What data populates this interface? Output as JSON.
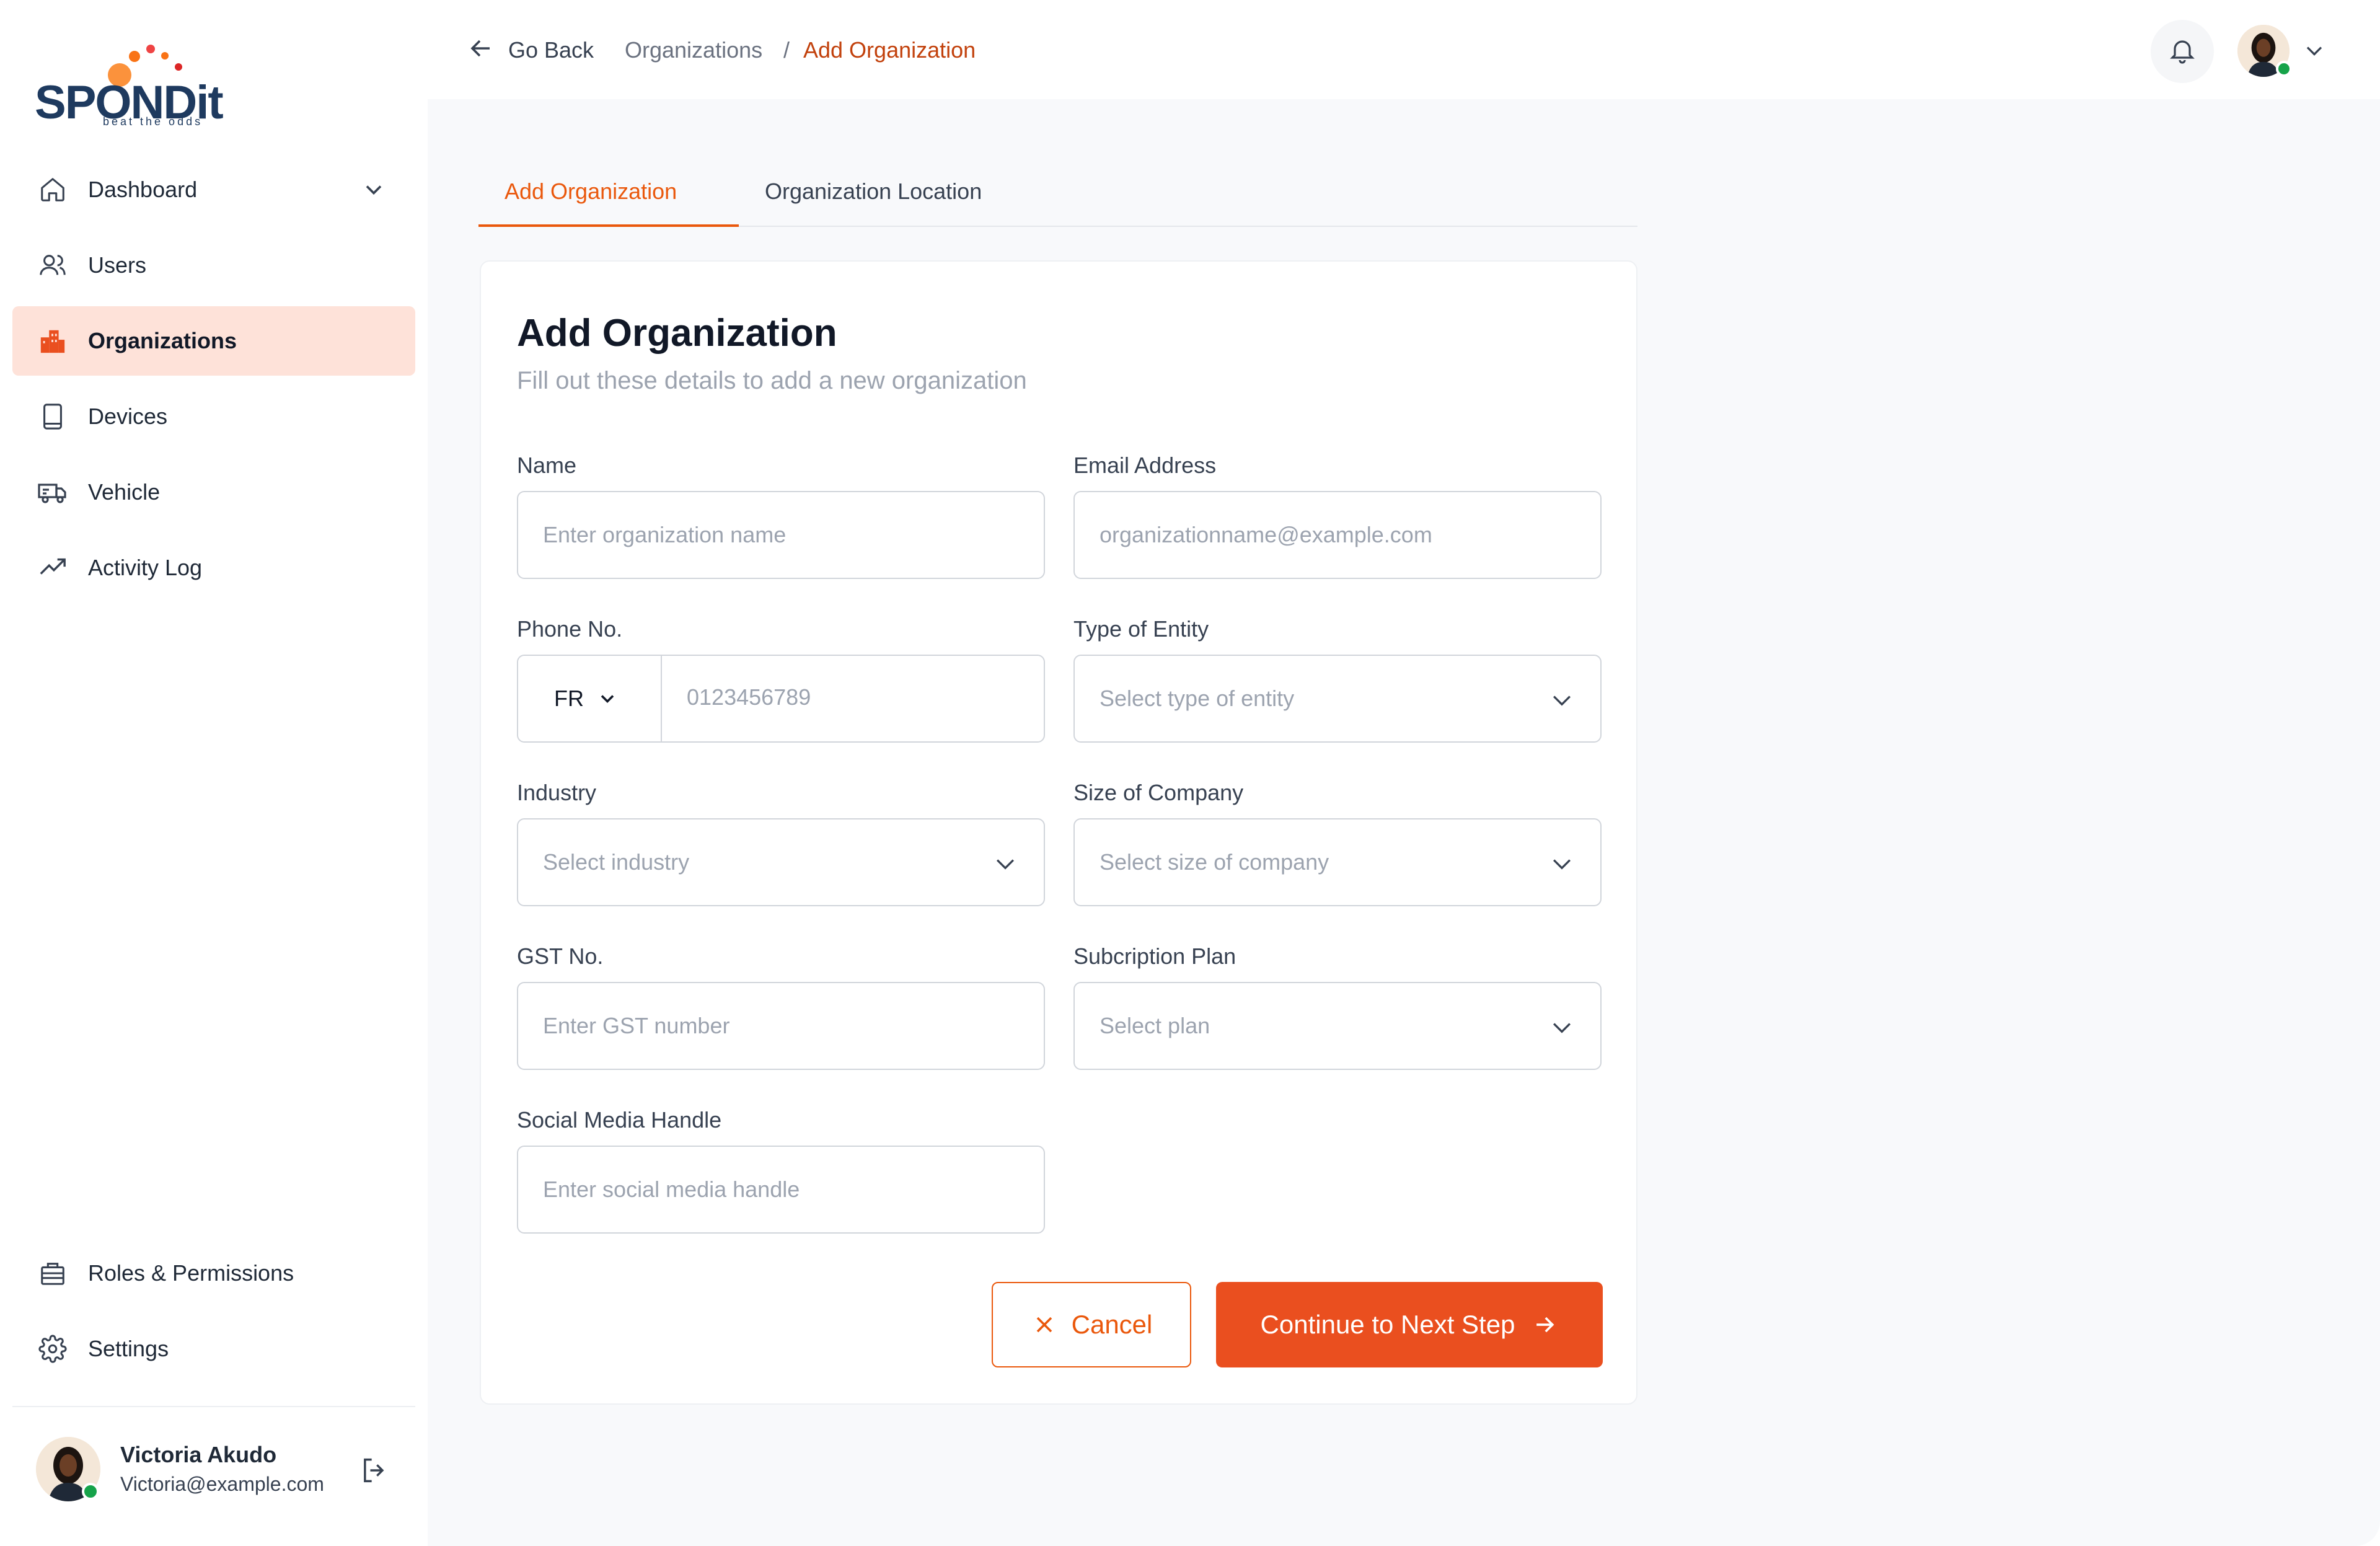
{
  "brand": {
    "name": "SPONDit",
    "tagline": "beat the odds",
    "colors": {
      "primary": "#ea4f1f",
      "active_bg": "#fee2d9",
      "navy": "#1e3a5f",
      "online": "#16a34a"
    }
  },
  "sidebar": {
    "items": [
      {
        "label": "Dashboard",
        "icon": "home-icon",
        "has_chevron": true
      },
      {
        "label": "Users",
        "icon": "users-icon"
      },
      {
        "label": "Organizations",
        "icon": "building-icon",
        "active": true
      },
      {
        "label": "Devices",
        "icon": "tablet-icon"
      },
      {
        "label": "Vehicle",
        "icon": "truck-icon"
      },
      {
        "label": "Activity Log",
        "icon": "trending-up-icon"
      }
    ],
    "bottom_items": [
      {
        "label": "Roles & Permissions",
        "icon": "briefcase-icon"
      },
      {
        "label": "Settings",
        "icon": "gear-icon"
      }
    ],
    "user": {
      "name": "Victoria Akudo",
      "email": "Victoria@example.com"
    }
  },
  "header": {
    "back_label": "Go Back",
    "breadcrumb": {
      "parent": "Organizations",
      "separator": "/",
      "current": "Add Organization"
    }
  },
  "tabs": [
    {
      "label": "Add Organization",
      "active": true
    },
    {
      "label": "Organization Location",
      "active": false
    }
  ],
  "form": {
    "title": "Add Organization",
    "subtitle": "Fill out these details to add a new organization",
    "fields": {
      "name": {
        "label": "Name",
        "placeholder": "Enter organization name"
      },
      "email": {
        "label": "Email Address",
        "placeholder": "organizationname@example.com"
      },
      "phone": {
        "label": "Phone No.",
        "country_code": "FR",
        "placeholder": "0123456789"
      },
      "entity": {
        "label": "Type of Entity",
        "placeholder": "Select type of entity"
      },
      "industry": {
        "label": "Industry",
        "placeholder": "Select industry"
      },
      "size": {
        "label": "Size of Company",
        "placeholder": "Select size of company"
      },
      "gst": {
        "label": "GST No.",
        "placeholder": "Enter GST number"
      },
      "plan": {
        "label": "Subcription Plan",
        "placeholder": "Select plan"
      },
      "social": {
        "label": "Social Media Handle",
        "placeholder": "Enter social media handle"
      }
    },
    "cancel_label": "Cancel",
    "next_label": "Continue to Next Step"
  }
}
